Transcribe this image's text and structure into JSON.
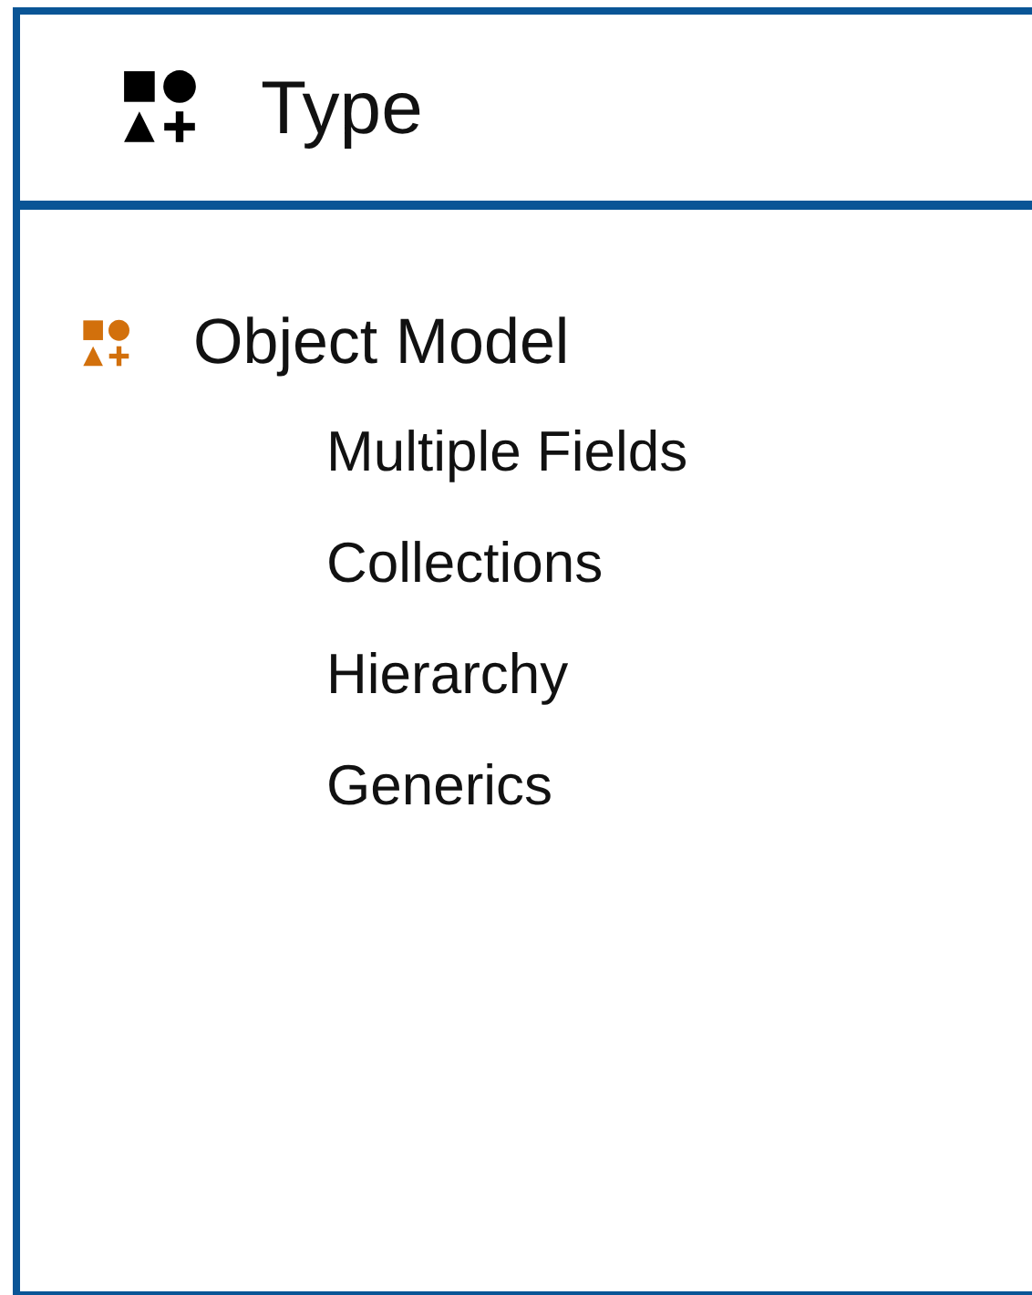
{
  "header": {
    "title": "Type"
  },
  "tree": [
    {
      "label": "Object Model",
      "children": [
        {
          "label": "Multiple Fields"
        },
        {
          "label": "Collections"
        },
        {
          "label": "Hierarchy"
        },
        {
          "label": "Generics"
        }
      ]
    }
  ]
}
